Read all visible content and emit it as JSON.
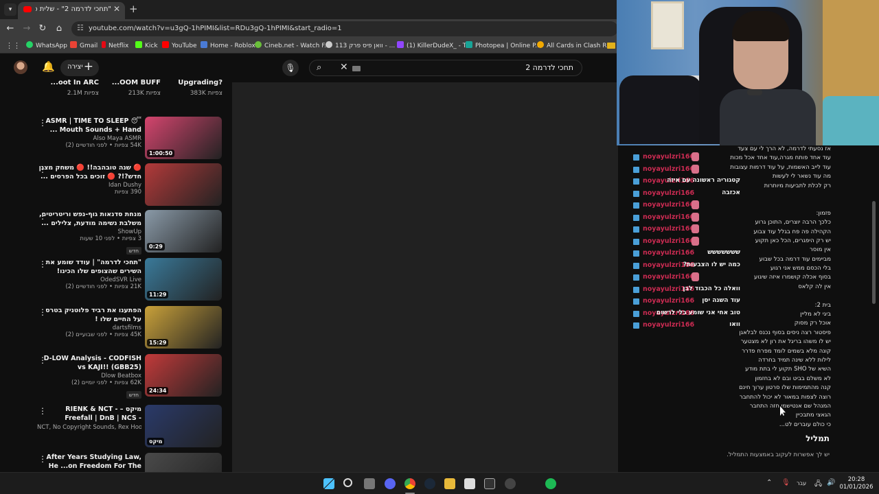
{
  "browser": {
    "tab_title": "\"תחכי לדרמה 2\" - שלית פי...",
    "url": "youtube.com/watch?v=u3gQ-1hPIMI&list=RDu3gQ-1hPIMI&start_radio=1",
    "bookmarks": [
      {
        "label": "WhatsApp",
        "color": "#25d366"
      },
      {
        "label": "Gmail",
        "color": "#ea4335"
      },
      {
        "label": "Netflix",
        "color": "#e50914"
      },
      {
        "label": "Kick",
        "color": "#53fc18"
      },
      {
        "label": "YouTube",
        "color": "#ff0000"
      },
      {
        "label": "Home - Roblox",
        "color": "#4a7bd5"
      },
      {
        "label": "Cineb.net - Watch F...",
        "color": "#6abf3a"
      },
      {
        "label": "וואן פיס פרק 113 - ...",
        "color": "#cccccc"
      },
      {
        "label": "(1) KillerDudeX_ - T...",
        "color": "#9146ff"
      },
      {
        "label": "Photopea | Online P...",
        "color": "#18a497"
      },
      {
        "label": "All Cards in Clash R...",
        "color": "#f2a900"
      }
    ]
  },
  "yt_header": {
    "create_label": "יצירה",
    "search_query": "תחכי לדרמה 2"
  },
  "shorts": [
    {
      "title": "...oot In ARC",
      "views": "2.1M צפיות"
    },
    {
      "title": "...OOM BUFF",
      "views": "213K צפיות"
    },
    {
      "title": "Upgrading?",
      "views": "383K צפיות"
    }
  ],
  "recommendations": [
    {
      "title": "ASMR | TIME TO SLEEP 😴 Mouth Sounds + Hand ...",
      "channel": "Also Maya ASMR",
      "stats": "54K צפיות • לפני חודשיים (2)",
      "duration": "1:00:50",
      "badge": "",
      "thumb": "#d4456e"
    },
    {
      "title": "🔴 שנה טובהבה!! 🔴 משחק מצגן חדש?!? 🔴 זוכים בכל הפרסים ...",
      "channel": "Idan Dushy",
      "stats": "390 צפיות",
      "duration": "",
      "badge": "",
      "thumb": "#b33a3a"
    },
    {
      "title": "מנחת סדנאות גוף-נפש וריטריטים, משלבת נשימה מודעת, צלילים ...",
      "channel": "ShowUp",
      "stats": "3 צפיות • לפני 10 שעות",
      "duration": "0:29",
      "badge": "חדש",
      "thumb": "#8a9aa8"
    },
    {
      "title": "\"תחכי לדרמה\" | עודד שומע את השירים שהצופים שלו הכינו!",
      "channel": "OdedSVR Live",
      "stats": "21K צפיות • לפני חודשיים (2)",
      "duration": "11:29",
      "badge": "",
      "thumb": "#3a7a9a"
    },
    {
      "title": "הפתענו את רביד פלוטניק בטרס על החיים שלו !",
      "channel": "dartsfilms",
      "stats": "45K צפיות • לפני שבועיים (2)",
      "duration": "15:29",
      "badge": "",
      "thumb": "#c9a13a"
    },
    {
      "title": "D-LOW Analysis - CODFISH vs KAJI!! (GBB25)",
      "channel": "Dlow Beatbox",
      "stats": "62K צפיות • לפני יומיים (2)",
      "duration": "24:34",
      "badge": "חדש",
      "thumb": "#c23a3a"
    },
    {
      "title": "מיקס – RIENK & NCT - Freefall | DnB | NCS - Copyright Free",
      "channel": "NCT, No Copyright Sounds, Rex Hooligan...",
      "stats": "",
      "duration": "מיקס",
      "badge": "",
      "thumb": "#2a3a6a"
    },
    {
      "title": "After Years Studying Law, He ...on Freedom For The Innocent",
      "channel": "",
      "stats": "",
      "duration": "",
      "badge": "",
      "thumb": "#4a4a4a"
    }
  ],
  "chat": {
    "username": "noyayulzri166",
    "messages": [
      {
        "text": "",
        "emote": true
      },
      {
        "text": "",
        "emote": true
      },
      {
        "text": "קטגוריה ראשונה עם איזה",
        "emote": false
      },
      {
        "text": "אכזבה",
        "emote": false
      },
      {
        "text": "",
        "emote": true
      },
      {
        "text": "",
        "emote": true
      },
      {
        "text": "",
        "emote": true
      },
      {
        "text": "",
        "emote": true
      },
      {
        "text": "ששששששש",
        "emote": false
      },
      {
        "text": "כמה יש לו הצבעות?",
        "emote": false
      },
      {
        "text": "",
        "emote": true
      },
      {
        "text": "וואלה כל הכבוד לבן",
        "emote": false
      },
      {
        "text": "עוד השנה יסן",
        "emote": false
      },
      {
        "text": "טוב אחי אני שומע בלי לרשום",
        "emote": false
      },
      {
        "text": "וואו",
        "emote": false
      }
    ]
  },
  "lyrics": [
    "אז נסעתי לדרמה, לא הרך לי עם צעד",
    "עוד אחד פותח מגרה,עוד אחד אכל מכות",
    "עוד לייב האשמות, על עוד דרמות עצובות",
    "מה עוד נשאר לי לעשות",
    "רק לכלת לתביעות מיותרות",
    "",
    "",
    "פזמון:",
    "כלכך הרבה יוצרים, התוכן גרוע",
    "הקהילה פה פח בגלל עוד צבוע",
    "יש רק היפגרים, הכל כאן תקוע",
    "אין מוסר",
    "מביימים עוד דרמה בכל שבוע",
    "בלי הכסם ממש אני רגוע",
    "בסוף אכלה קושמרו איזה שיגוע",
    "אין לה קלאס",
    "",
    "בית 2:",
    "ביגי לא מליין",
    "אוכל רק מסוק",
    "פיסטור רצה ניסים בסוף נכנס לבלאגן",
    "יש לו משהו בריגל את רון לא מצטער",
    "קונה מלא בשמים לומד מפרח פדרר",
    "לילות ללא שינה תמיד בחרדה",
    "השיא של SHO תקוע לי בתת מודע",
    "לא משלם בביט ובם לא בחזמון",
    "קנה מהתמימות שלו סרטון ערוך חינם",
    "רוצה לצפות במאור לא יכול להתחבר",
    "המנהל שם אנטישמי חזה התחבר",
    "הגאצי מתבכיין",
    "כי כולם עוברים לט..."
  ],
  "playlist": {
    "title": "תמליל",
    "subtitle": "יש לך אפשרות לעקוב באמצעות התמליל."
  },
  "taskbar": {
    "lang": "עבר",
    "time": "20:28",
    "date": "01/01/2026"
  }
}
